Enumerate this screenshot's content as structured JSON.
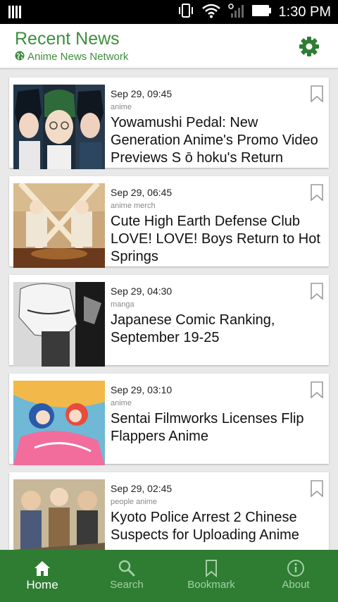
{
  "status_bar": {
    "time": "1:30 PM"
  },
  "header": {
    "title": "Recent News",
    "source": "Anime News Network",
    "settings_icon": "gear-icon"
  },
  "colors": {
    "brand": "#3e8e3e",
    "nav_bg": "#2e7d32",
    "nav_inactive": "#a5cfa7"
  },
  "news": [
    {
      "date": "Sep 29, 09:45",
      "category": "anime",
      "title": "Yowamushi Pedal: New Generation Anime's Promo Video Previews S ō hoku's Return"
    },
    {
      "date": "Sep 29, 06:45",
      "category": "anime merch",
      "title": "Cute High Earth Defense Club LOVE! LOVE! Boys Return to Hot Springs"
    },
    {
      "date": "Sep 29, 04:30",
      "category": "manga",
      "title": "Japanese Comic Ranking, September 19-25"
    },
    {
      "date": "Sep 29, 03:10",
      "category": "anime",
      "title": "Sentai Filmworks Licenses Flip Flappers Anime"
    },
    {
      "date": "Sep 29, 02:45",
      "category": "people anime",
      "title": "Kyoto Police Arrest 2 Chinese Suspects for Uploading Anime"
    }
  ],
  "nav": [
    {
      "label": "Home",
      "icon": "home-icon",
      "active": true
    },
    {
      "label": "Search",
      "icon": "search-icon",
      "active": false
    },
    {
      "label": "Bookmark",
      "icon": "bookmark-icon",
      "active": false
    },
    {
      "label": "About",
      "icon": "info-icon",
      "active": false
    }
  ]
}
